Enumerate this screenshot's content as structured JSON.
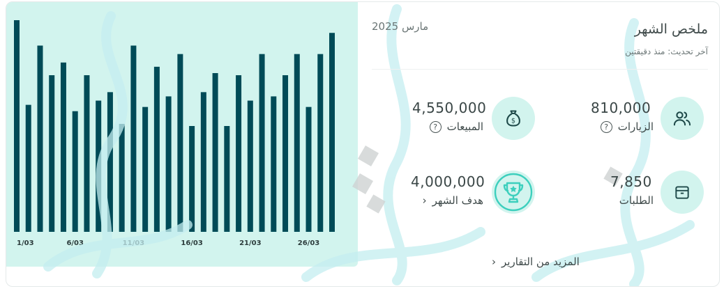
{
  "summary": {
    "title": "ملخص الشهر",
    "last_update": "آخر تحديث: منذ دقيقتين",
    "period": "مارس 2025"
  },
  "stats": {
    "visits": {
      "value": "810,000",
      "label": "الزيارات",
      "icon": "users-icon"
    },
    "sales": {
      "value": "4,550,000",
      "label": "المبيعات",
      "icon": "money-bag-icon"
    },
    "orders": {
      "value": "7,850",
      "label": "الطلبات",
      "icon": "box-icon"
    },
    "goal": {
      "value": "4,000,000",
      "label": "هدف الشهر",
      "icon": "trophy-icon"
    }
  },
  "more_reports": "المزيد من التقارير",
  "colors": {
    "bar": "#004b57",
    "panel": "#d2f4ee",
    "icon": "#1f4a4a",
    "trophy": "#3ccfbd"
  },
  "chart_data": {
    "type": "bar",
    "categories": [
      "1/03",
      "2/03",
      "3/03",
      "4/03",
      "5/03",
      "6/03",
      "7/03",
      "8/03",
      "9/03",
      "10/03",
      "11/03",
      "12/03",
      "13/03",
      "14/03",
      "15/03",
      "16/03",
      "17/03",
      "18/03",
      "19/03",
      "20/03",
      "21/03",
      "22/03",
      "23/03",
      "24/03",
      "25/03",
      "26/03",
      "27/03",
      "28/03"
    ],
    "tick_labels": [
      "1/03",
      "6/03",
      "11/03",
      "16/03",
      "21/03",
      "26/03"
    ],
    "values": [
      100,
      60,
      88,
      74,
      80,
      57,
      74,
      62,
      66,
      51,
      88,
      59,
      78,
      64,
      84,
      50,
      66,
      75,
      50,
      74,
      62,
      84,
      64,
      74,
      84,
      59,
      84,
      94
    ],
    "ylim": [
      0,
      100
    ],
    "grid": false,
    "title": "",
    "xlabel": "",
    "ylabel": ""
  }
}
